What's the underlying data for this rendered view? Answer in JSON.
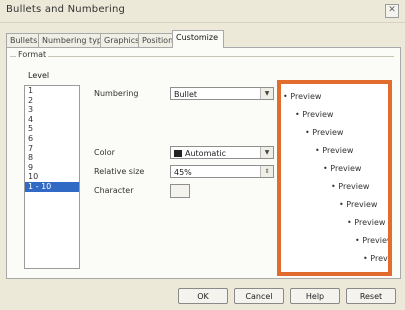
{
  "window": {
    "title": "Bullets and Numbering",
    "close_glyph": "✕"
  },
  "tabs": [
    {
      "label": "Bullets"
    },
    {
      "label": "Numbering type"
    },
    {
      "label": "Graphics"
    },
    {
      "label": "Position"
    },
    {
      "label": "Customize",
      "active": true
    }
  ],
  "format": {
    "group_label": "Format",
    "level_label": "Level",
    "levels": [
      "1",
      "2",
      "3",
      "4",
      "5",
      "6",
      "7",
      "8",
      "9",
      "10",
      "1 - 10"
    ],
    "selected_level": "1 - 10",
    "numbering_label": "Numbering",
    "numbering_value": "Bullet",
    "color_label": "Color",
    "color_value": "Automatic",
    "relative_size_label": "Relative size",
    "relative_size_value": "45%",
    "character_label": "Character"
  },
  "preview": {
    "lines": [
      "Preview",
      "Preview",
      "Preview",
      "Preview",
      "Preview",
      "Preview",
      "Preview",
      "Preview",
      "Preview",
      "Preview"
    ],
    "border_color": "#e26c2e"
  },
  "buttons": {
    "ok": "OK",
    "cancel": "Cancel",
    "help": "Help",
    "reset": "Reset"
  }
}
